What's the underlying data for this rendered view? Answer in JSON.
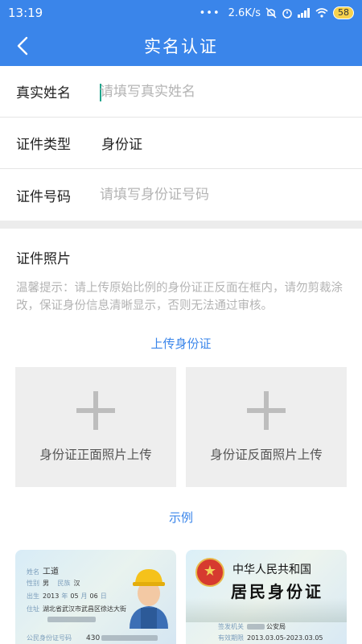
{
  "status_bar": {
    "time": "13:19",
    "dots": "•••",
    "network_speed": "2.6K/s",
    "battery": "58"
  },
  "nav": {
    "title": "实名认证",
    "back_icon": "chevron-left-icon"
  },
  "form": {
    "name_label": "真实姓名",
    "name_placeholder": "请填写真实姓名",
    "id_type_label": "证件类型",
    "id_type_value": "身份证",
    "id_number_label": "证件号码",
    "id_number_placeholder": "请填写身份证号码"
  },
  "photos": {
    "section_title": "证件照片",
    "tip": "温馨提示：请上传原始比例的身份证正反面在框内，请勿剪裁涂改，保证身份信息清晰显示，否则无法通过审核。",
    "upload_link": "上传身份证",
    "front_caption": "身份证正面照片上传",
    "back_caption": "身份证反面照片上传",
    "example_link": "示例"
  },
  "sample_front": {
    "name_key": "姓名",
    "name_value": "工道",
    "gender_key": "性别",
    "gender_value": "男",
    "ethnic_key": "民族",
    "ethnic_value": "汉",
    "birth_key": "出生",
    "birth_year": "2013",
    "birth_year_unit": "年",
    "birth_month": "05",
    "birth_month_unit": "月",
    "birth_day": "06",
    "birth_day_unit": "日",
    "address_key": "住址",
    "address_value": "湖北省武汉市武昌区徐达大街",
    "id_key": "公民身份证号码",
    "id_prefix": "430"
  },
  "sample_back": {
    "title_line1": "中华人民共和国",
    "title_line2": "居民身份证",
    "authority_key": "签发机关",
    "authority_value": "公安局",
    "validity_key": "有效期限",
    "validity_value": "2013.03.05-2023.03.05"
  },
  "colors": {
    "primary": "#3a85ea",
    "placeholder": "#b4b4b4",
    "upload_bg": "#eeeeee"
  }
}
